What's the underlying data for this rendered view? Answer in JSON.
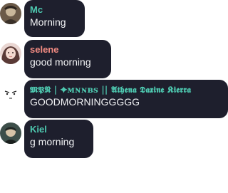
{
  "messages": [
    {
      "author": "Mc",
      "author_color": "#4ec9b0",
      "text": "Morning",
      "avatar": "avatar-mc-icon"
    },
    {
      "author": "selene",
      "author_color": "#f28b82",
      "text": "good morning",
      "avatar": "avatar-selene-icon"
    },
    {
      "author": "𝕸𝕻𝕹 | ✦ᴍɴɴʙs || 𝕬𝖙𝖍𝖊𝖓𝖆 𝕯𝖆𝖝𝖎𝖓𝖊 𝕶𝖎𝖊𝖗𝖗𝖆",
      "author_color": "#4ec9b0",
      "text": "GOODMORNINGGGGG",
      "avatar": "avatar-face-icon"
    },
    {
      "author": "Kiel",
      "author_color": "#4ec9b0",
      "text": "g morning",
      "avatar": "avatar-kiel-icon"
    }
  ]
}
